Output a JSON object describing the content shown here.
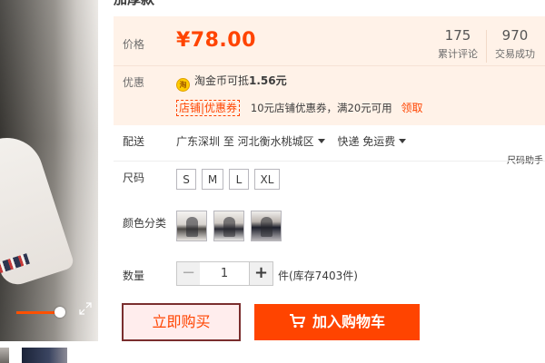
{
  "product": {
    "title": "加厚款"
  },
  "price_box": {
    "price_label": "价格",
    "price": "¥78.00",
    "stats": [
      {
        "value": "175",
        "label": "累计评论"
      },
      {
        "value": "970",
        "label": "交易成功"
      }
    ],
    "promo_label": "优惠",
    "coin_text_prefix": "淘金币可抵",
    "coin_amount": "1.56元",
    "coupon_tag": "店铺|优惠券",
    "coupon_desc": "10元店铺优惠券，满20元可用",
    "coupon_link": "领取"
  },
  "shipping": {
    "label": "配送",
    "route": "广东深圳 至  河北衡水桃城区",
    "method": "快递 免运费",
    "size_help": "尺码助手"
  },
  "size": {
    "label": "尺码",
    "options": [
      "S",
      "M",
      "L",
      "XL"
    ]
  },
  "color": {
    "label": "颜色分类"
  },
  "quantity": {
    "label": "数量",
    "minus": "−",
    "value": "1",
    "plus": "+",
    "stock": "件(库存7403件)"
  },
  "actions": {
    "buy_now": "立即购买",
    "add_to_cart": "加入购物车"
  },
  "colors": {
    "accent": "#ff4400",
    "price_bg": "#fff2e8"
  }
}
